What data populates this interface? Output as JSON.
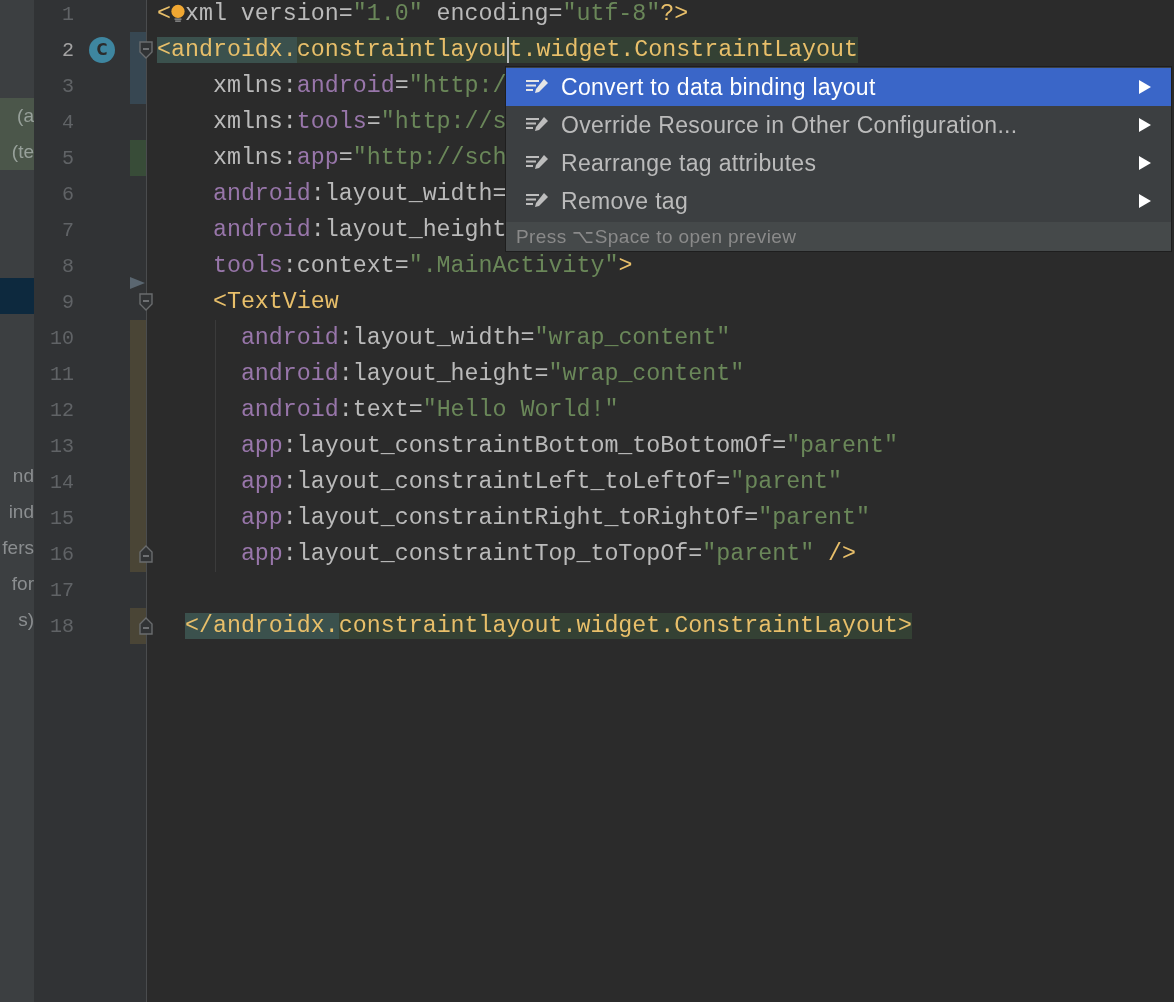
{
  "side_panel": {
    "rows": [
      {
        "highlighted": false,
        "selected": false
      },
      {
        "highlighted": false,
        "selected": false
      },
      {
        "highlighted": false,
        "selected": false
      },
      {
        "text": "(a",
        "highlighted": true,
        "selected": false
      },
      {
        "text": "(te",
        "highlighted": true,
        "selected": false
      },
      {
        "highlighted": false,
        "selected": false
      },
      {
        "highlighted": false,
        "selected": false
      },
      {
        "highlighted": false,
        "selected": false
      },
      {
        "highlighted": false,
        "selected": true
      },
      {
        "highlighted": false,
        "selected": false
      },
      {
        "highlighted": false,
        "selected": false
      },
      {
        "highlighted": false,
        "selected": false
      },
      {
        "highlighted": false,
        "selected": false
      },
      {
        "text": "nd",
        "highlighted": false,
        "selected": false
      },
      {
        "text": "ind",
        "highlighted": false,
        "selected": false
      },
      {
        "text": "fers",
        "highlighted": false,
        "selected": false
      },
      {
        "text": "for",
        "highlighted": false,
        "selected": false
      },
      {
        "text": "s)",
        "highlighted": false,
        "selected": false
      }
    ]
  },
  "editor": {
    "lines": [
      {
        "number": "1",
        "current": false,
        "tokens": [
          {
            "kind": "tag",
            "text": "<"
          },
          {
            "kind": "bulb"
          },
          {
            "kind": "plain",
            "text": "xml version="
          },
          {
            "kind": "value",
            "text": "\"1.0\""
          },
          {
            "kind": "plain",
            "text": " encoding="
          },
          {
            "kind": "value",
            "text": "\"utf-8\""
          },
          {
            "kind": "tag",
            "text": "?>"
          }
        ]
      },
      {
        "number": "2",
        "current": true,
        "badge": "C",
        "change": {
          "kind": "bar",
          "color": "#374752"
        },
        "fold_start": true,
        "tokens": [
          {
            "kind": "tag-match-prefix",
            "text": "<androidx."
          },
          {
            "kind": "tag-match-name",
            "text": "constraintlayou",
            "caret": true
          },
          {
            "kind": "tag-match-name",
            "text": "t.widget.ConstraintLayout"
          }
        ]
      },
      {
        "number": "3",
        "current": false,
        "change": {
          "kind": "bar",
          "color": "#374752"
        },
        "tokens": [
          {
            "kind": "plain",
            "text": "    xmlns:"
          },
          {
            "kind": "ns",
            "text": "android"
          },
          {
            "kind": "plain",
            "text": "="
          },
          {
            "kind": "value",
            "text": "\"http:/"
          }
        ]
      },
      {
        "number": "4",
        "current": false,
        "tokens": [
          {
            "kind": "plain",
            "text": "    xmlns:"
          },
          {
            "kind": "ns",
            "text": "tools"
          },
          {
            "kind": "plain",
            "text": "="
          },
          {
            "kind": "value",
            "text": "\"http://s"
          }
        ]
      },
      {
        "number": "5",
        "current": false,
        "change": {
          "kind": "bar",
          "color": "#384c38"
        },
        "tokens": [
          {
            "kind": "plain",
            "text": "    xmlns:"
          },
          {
            "kind": "ns",
            "text": "app"
          },
          {
            "kind": "plain",
            "text": "="
          },
          {
            "kind": "value",
            "text": "\"http://sch"
          }
        ]
      },
      {
        "number": "6",
        "current": false,
        "tokens": [
          {
            "kind": "ns",
            "text": "    android"
          },
          {
            "kind": "plain",
            "text": ":layout_width="
          }
        ]
      },
      {
        "number": "7",
        "current": false,
        "tokens": [
          {
            "kind": "ns",
            "text": "    android"
          },
          {
            "kind": "plain",
            "text": ":layout_height"
          }
        ]
      },
      {
        "number": "8",
        "current": false,
        "change": {
          "kind": "triangle",
          "color": "#5a6670"
        },
        "tokens": [
          {
            "kind": "ns",
            "text": "    tools"
          },
          {
            "kind": "plain",
            "text": ":context="
          },
          {
            "kind": "value",
            "text": "\".MainActivity\""
          },
          {
            "kind": "tag",
            "text": ">"
          }
        ]
      },
      {
        "number": "9",
        "current": false,
        "fold_start": true,
        "tokens": [
          {
            "kind": "tag",
            "text": "    <TextView"
          }
        ]
      },
      {
        "number": "10",
        "current": false,
        "change": {
          "kind": "bar",
          "color": "#4a4536"
        },
        "guide": true,
        "tokens": [
          {
            "kind": "ns",
            "text": "      android"
          },
          {
            "kind": "plain",
            "text": ":layout_width="
          },
          {
            "kind": "value",
            "text": "\"wrap_content\""
          }
        ]
      },
      {
        "number": "11",
        "current": false,
        "change": {
          "kind": "bar",
          "color": "#4a4536"
        },
        "guide": true,
        "tokens": [
          {
            "kind": "ns",
            "text": "      android"
          },
          {
            "kind": "plain",
            "text": ":layout_height="
          },
          {
            "kind": "value",
            "text": "\"wrap_content\""
          }
        ]
      },
      {
        "number": "12",
        "current": false,
        "change": {
          "kind": "bar",
          "color": "#4a4536"
        },
        "guide": true,
        "tokens": [
          {
            "kind": "ns",
            "text": "      android"
          },
          {
            "kind": "plain",
            "text": ":text="
          },
          {
            "kind": "value",
            "text": "\"Hello World!\""
          }
        ]
      },
      {
        "number": "13",
        "current": false,
        "change": {
          "kind": "bar",
          "color": "#4a4536"
        },
        "guide": true,
        "tokens": [
          {
            "kind": "ns",
            "text": "      app"
          },
          {
            "kind": "plain",
            "text": ":layout_constraintBottom_toBottomOf="
          },
          {
            "kind": "value",
            "text": "\"parent\""
          }
        ]
      },
      {
        "number": "14",
        "current": false,
        "change": {
          "kind": "bar",
          "color": "#4a4536"
        },
        "guide": true,
        "tokens": [
          {
            "kind": "ns",
            "text": "      app"
          },
          {
            "kind": "plain",
            "text": ":layout_constraintLeft_toLeftOf="
          },
          {
            "kind": "value",
            "text": "\"parent\""
          }
        ]
      },
      {
        "number": "15",
        "current": false,
        "change": {
          "kind": "bar",
          "color": "#4a4536"
        },
        "guide": true,
        "tokens": [
          {
            "kind": "ns",
            "text": "      app"
          },
          {
            "kind": "plain",
            "text": ":layout_constraintRight_toRightOf="
          },
          {
            "kind": "value",
            "text": "\"parent\""
          }
        ]
      },
      {
        "number": "16",
        "current": false,
        "change": {
          "kind": "bar",
          "color": "#4a4536"
        },
        "guide": true,
        "fold_end": true,
        "tokens": [
          {
            "kind": "ns",
            "text": "      app"
          },
          {
            "kind": "plain",
            "text": ":layout_constraintTop_toTopOf="
          },
          {
            "kind": "value",
            "text": "\"parent\""
          },
          {
            "kind": "tag",
            "text": " />"
          }
        ]
      },
      {
        "number": "17",
        "current": false
      },
      {
        "number": "18",
        "current": false,
        "change": {
          "kind": "bar",
          "color": "#4a4536"
        },
        "fold_end": true,
        "tokens": [
          {
            "kind": "tag-match-prefix",
            "text": "  </androidx."
          },
          {
            "kind": "tag-match-name",
            "text": "constraintlayout.widget.ConstraintLayout>"
          }
        ]
      }
    ]
  },
  "context_menu": {
    "items": [
      {
        "label": "Convert to data binding layout",
        "selected": true,
        "submenu": true
      },
      {
        "label": "Override Resource in Other Configuration...",
        "selected": false,
        "submenu": true
      },
      {
        "label": "Rearrange tag attributes",
        "selected": false,
        "submenu": true
      },
      {
        "label": "Remove tag",
        "selected": false,
        "submenu": true
      }
    ],
    "hint": "Press ⌥Space to open preview"
  }
}
